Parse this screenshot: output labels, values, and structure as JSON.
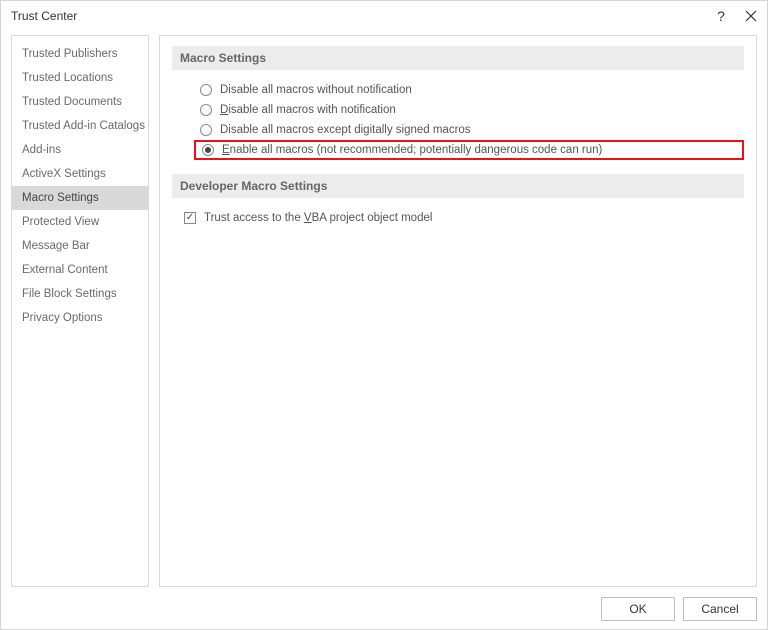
{
  "dialog": {
    "title": "Trust Center"
  },
  "sidebar": {
    "items": [
      {
        "label": "Trusted Publishers"
      },
      {
        "label": "Trusted Locations"
      },
      {
        "label": "Trusted Documents"
      },
      {
        "label": "Trusted Add-in Catalogs"
      },
      {
        "label": "Add-ins"
      },
      {
        "label": "ActiveX Settings"
      },
      {
        "label": "Macro Settings"
      },
      {
        "label": "Protected View"
      },
      {
        "label": "Message Bar"
      },
      {
        "label": "External Content"
      },
      {
        "label": "File Block Settings"
      },
      {
        "label": "Privacy Options"
      }
    ],
    "selected_index": 6
  },
  "macro_settings": {
    "header": "Macro Settings",
    "option1_pre": "Disable all macros without notification",
    "option2_pre": "D",
    "option2_mid": "isable all macros with notification",
    "option3": "Disable all macros except digitally signed macros",
    "option4_pre": "E",
    "option4_mid": "nable all macros (not recommended; potentially dangerous code can run)",
    "selected": 3
  },
  "developer_settings": {
    "header": "Developer Macro Settings",
    "trust_vba_pre": "Trust access to the ",
    "trust_vba_u": "V",
    "trust_vba_post": "BA project object model",
    "trust_vba_checked": true
  },
  "buttons": {
    "ok": "OK",
    "cancel": "Cancel"
  }
}
